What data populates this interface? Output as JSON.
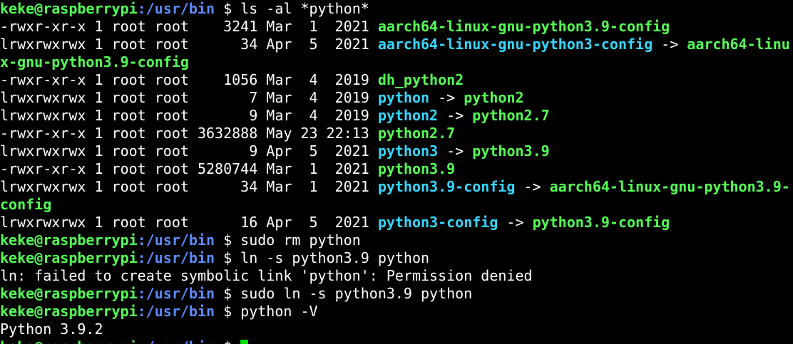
{
  "colors": {
    "background": "#000000",
    "text": "#ffffff",
    "prompt_user": "#55ff55",
    "prompt_path": "#5c8cff",
    "executable": "#55ff55",
    "symlink": "#36d7ff",
    "cursor": "#00e000"
  },
  "prompt": {
    "user_host": "keke@raspberrypi",
    "path": ":/usr/bin",
    "symbol": " $ "
  },
  "commands": {
    "ls": "ls -al *python*",
    "rm": "sudo rm python",
    "ln": "ln -s python3.9 python",
    "sudo_ln": "sudo ln -s python3.9 python",
    "version": "python -V"
  },
  "listing": [
    {
      "meta": "-rwxr-xr-x 1 root root    3241 Mar  1  2021 ",
      "name": "aarch64-linux-gnu-python3.9-config",
      "name_type": "exec",
      "arrow": "",
      "target": "",
      "target_type": ""
    },
    {
      "meta": "lrwxrwxrwx 1 root root      34 Apr  5  2021 ",
      "name": "aarch64-linux-gnu-python3-config",
      "name_type": "link",
      "arrow": " -> ",
      "target": "aarch64-linu",
      "target_type": "exec"
    },
    {
      "meta": "",
      "name": "",
      "name_type": "",
      "arrow": "",
      "target": "x-gnu-python3.9-config",
      "target_type": "exec"
    },
    {
      "meta": "-rwxr-xr-x 1 root root    1056 Mar  4  2019 ",
      "name": "dh_python2",
      "name_type": "exec",
      "arrow": "",
      "target": "",
      "target_type": ""
    },
    {
      "meta": "lrwxrwxrwx 1 root root       7 Mar  4  2019 ",
      "name": "python",
      "name_type": "link",
      "arrow": " -> ",
      "target": "python2",
      "target_type": "exec"
    },
    {
      "meta": "lrwxrwxrwx 1 root root       9 Mar  4  2019 ",
      "name": "python2",
      "name_type": "link",
      "arrow": " -> ",
      "target": "python2.7",
      "target_type": "exec"
    },
    {
      "meta": "-rwxr-xr-x 1 root root 3632888 May 23 22:13 ",
      "name": "python2.7",
      "name_type": "exec",
      "arrow": "",
      "target": "",
      "target_type": ""
    },
    {
      "meta": "lrwxrwxrwx 1 root root       9 Apr  5  2021 ",
      "name": "python3",
      "name_type": "link",
      "arrow": " -> ",
      "target": "python3.9",
      "target_type": "exec"
    },
    {
      "meta": "-rwxr-xr-x 1 root root 5280744 Mar  1  2021 ",
      "name": "python3.9",
      "name_type": "exec",
      "arrow": "",
      "target": "",
      "target_type": ""
    },
    {
      "meta": "lrwxrwxrwx 1 root root      34 Mar  1  2021 ",
      "name": "python3.9-config",
      "name_type": "link",
      "arrow": " -> ",
      "target": "aarch64-linux-gnu-python3.9-",
      "target_type": "exec"
    },
    {
      "meta": "",
      "name": "",
      "name_type": "",
      "arrow": "",
      "target": "config",
      "target_type": "exec"
    },
    {
      "meta": "lrwxrwxrwx 1 root root      16 Apr  5  2021 ",
      "name": "python3-config",
      "name_type": "link",
      "arrow": " -> ",
      "target": "python3.9-config",
      "target_type": "exec"
    }
  ],
  "output": {
    "ln_error": "ln: failed to create symbolic link 'python': Permission denied",
    "version": "Python 3.9.2"
  }
}
